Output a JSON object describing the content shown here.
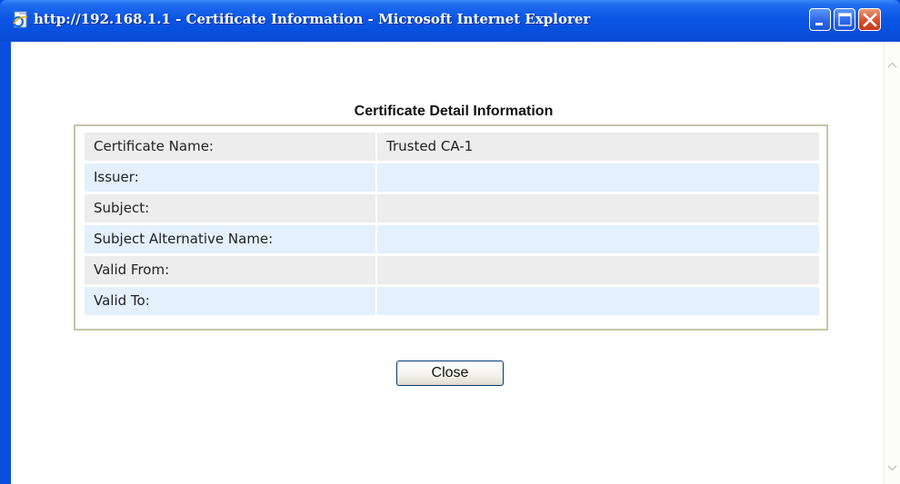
{
  "window": {
    "title": "http://192.168.1.1 - Certificate Information - Microsoft Internet Explorer",
    "icon": "ie-page-icon",
    "controls": [
      "minimize",
      "maximize",
      "close"
    ]
  },
  "page": {
    "heading": "Certificate Detail Information",
    "rows": [
      {
        "label": "Certificate Name:",
        "value": "Trusted CA-1"
      },
      {
        "label": "Issuer:",
        "value": ""
      },
      {
        "label": "Subject:",
        "value": ""
      },
      {
        "label": "Subject Alternative Name:",
        "value": ""
      },
      {
        "label": "Valid From:",
        "value": ""
      },
      {
        "label": "Valid To:",
        "value": ""
      }
    ],
    "close_label": "Close"
  },
  "colors": {
    "titlebar": "#0a4fe0",
    "row_gray": "#ededed",
    "row_blue": "#e4f0fc",
    "table_border": "#c8c4a8"
  }
}
